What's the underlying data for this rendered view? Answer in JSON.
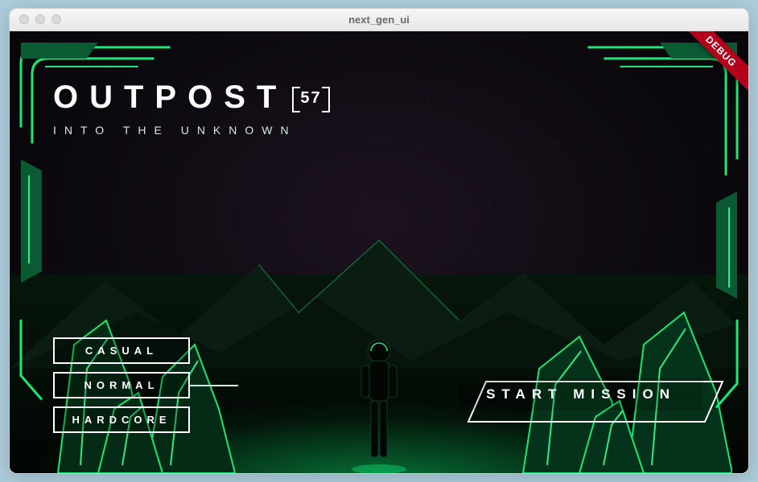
{
  "window": {
    "title": "next_gen_ui"
  },
  "debug_label": "DEBUG",
  "game": {
    "title": "OUTPOST",
    "badge": "57",
    "subtitle": "INTO THE UNKNOWN"
  },
  "difficulty": {
    "options": [
      {
        "label": "CASUAL"
      },
      {
        "label": "NORMAL"
      },
      {
        "label": "HARDCORE"
      }
    ]
  },
  "start_label": "START MISSION",
  "colors": {
    "accent": "#18f07a",
    "accent_dark": "#0a7a3d",
    "debug": "#b3001b"
  }
}
